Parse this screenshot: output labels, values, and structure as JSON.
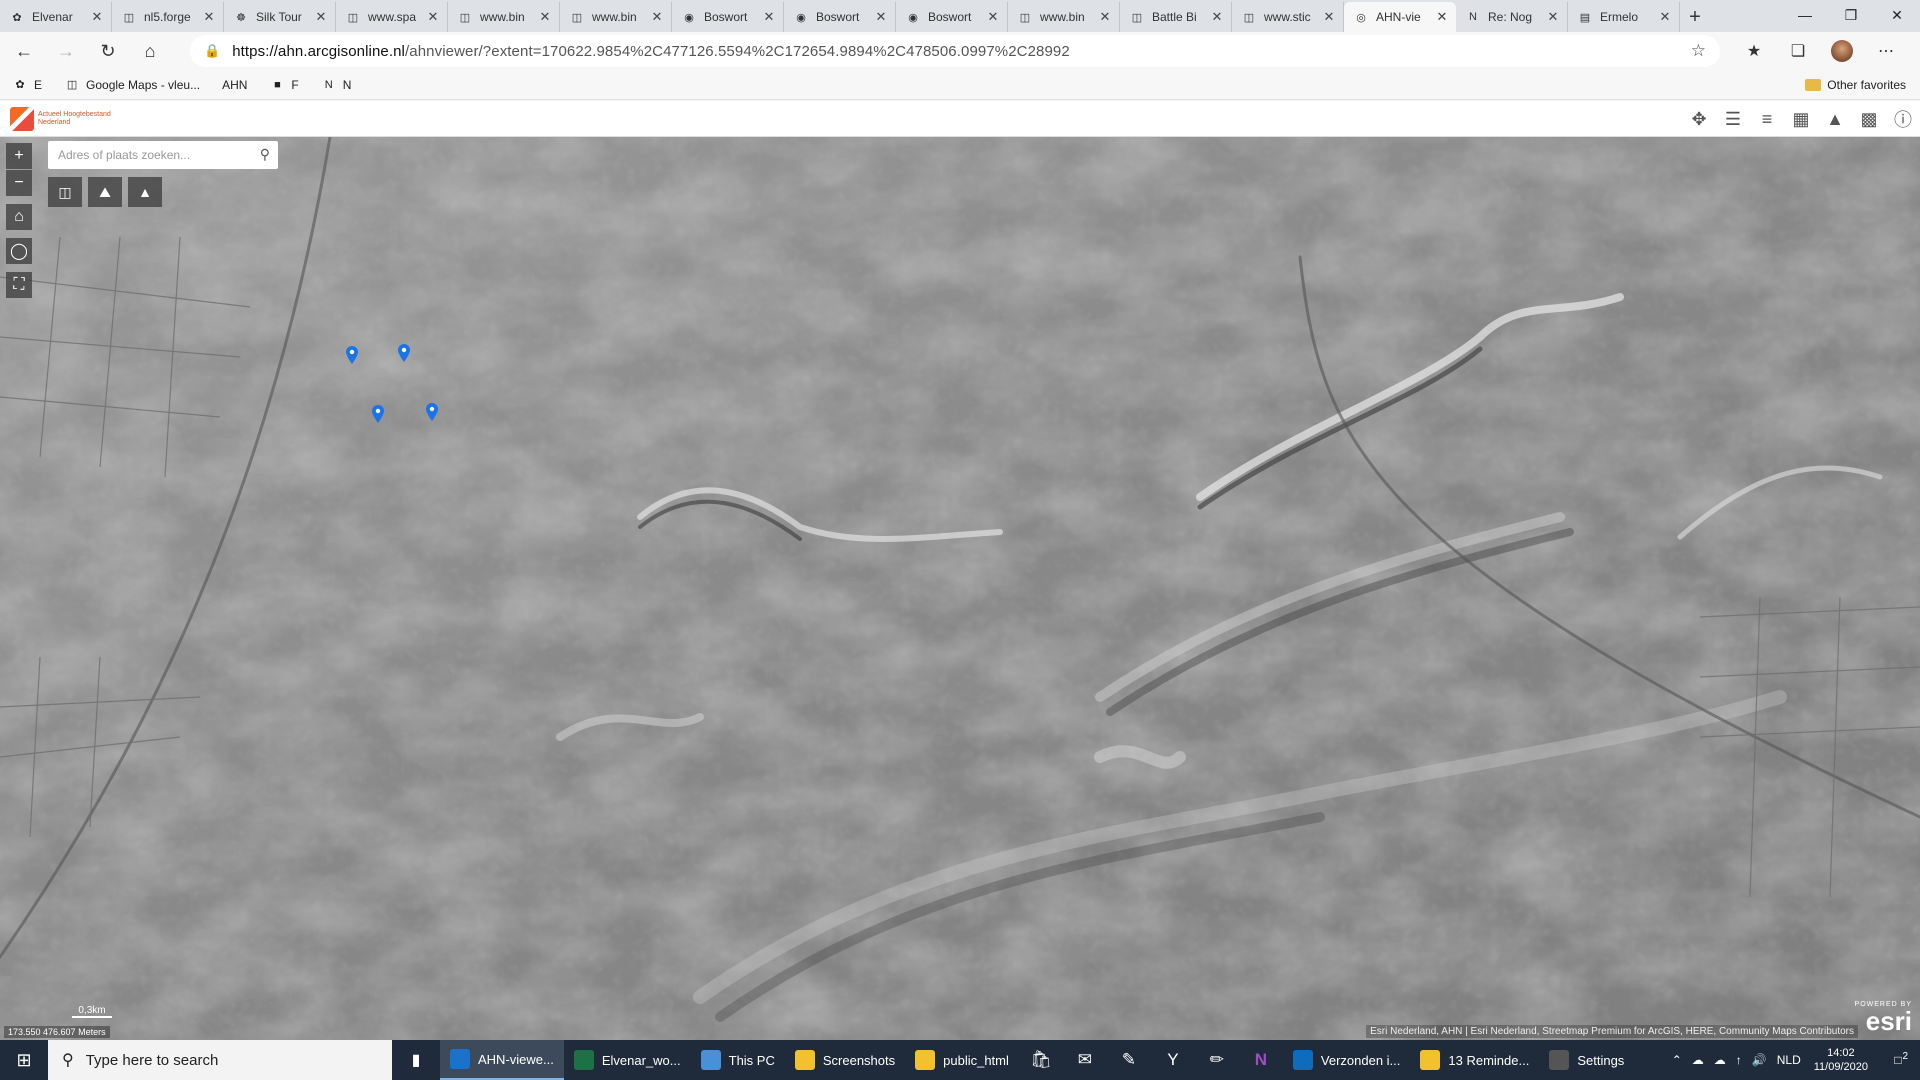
{
  "tabs": [
    {
      "title": "Elvenar",
      "icon": "elvenar-icon",
      "active": false
    },
    {
      "title": "nl5.forge",
      "icon": "page-icon",
      "active": false
    },
    {
      "title": "Silk Tour",
      "icon": "silk-icon",
      "active": false
    },
    {
      "title": "www.spa",
      "icon": "page-icon",
      "active": false
    },
    {
      "title": "www.bin",
      "icon": "page-icon",
      "active": false
    },
    {
      "title": "www.bin",
      "icon": "page-icon",
      "active": false
    },
    {
      "title": "Boswort",
      "icon": "bosworth-icon",
      "active": false
    },
    {
      "title": "Boswort",
      "icon": "bosworth-icon",
      "active": false
    },
    {
      "title": "Boswort",
      "icon": "bosworth-icon",
      "active": false
    },
    {
      "title": "www.bin",
      "icon": "page-icon",
      "active": false
    },
    {
      "title": "Battle Bi",
      "icon": "page-icon",
      "active": false
    },
    {
      "title": "www.stic",
      "icon": "page-icon",
      "active": false
    },
    {
      "title": "AHN-vie",
      "icon": "arcgis-icon",
      "active": true
    },
    {
      "title": "Re: Nog",
      "icon": "n-icon",
      "active": false
    },
    {
      "title": "Ermelo",
      "icon": "ermelo-icon",
      "active": false
    }
  ],
  "address": {
    "host": "https://ahn.arcgisonline.nl",
    "path": "/ahnviewer/?extent=170622.9854%2C477126.5594%2C172654.9894%2C478506.0997%2C28992"
  },
  "bookmarks": [
    {
      "label": "E",
      "icon": "elvenar-icon"
    },
    {
      "label": "Google Maps - vleu...",
      "icon": "page-icon"
    },
    {
      "label": "AHN",
      "icon": ""
    },
    {
      "label": "F",
      "icon": "forge-icon"
    },
    {
      "label": "N",
      "icon": "n-icon"
    }
  ],
  "other_favorites": "Other favorites",
  "app": {
    "logo_line1": "Actueel Hoogtebestand",
    "logo_line2": "Nederland"
  },
  "map": {
    "search_placeholder": "Adres of plaats zoeken...",
    "coords": "173.550 476.607 Meters",
    "scale": "0,3km",
    "attribution": "Esri Nederland, AHN | Esri Nederland, Streetmap Premium for ArcGIS, HERE, Community Maps Contributors",
    "esri_powered": "POWERED BY",
    "esri": "esri"
  },
  "taskbar": {
    "search_placeholder": "Type here to search",
    "apps": [
      {
        "label": "AHN-viewe...",
        "active": true,
        "color": "#1a73c8"
      },
      {
        "label": "Elvenar_wo...",
        "active": false,
        "color": "#1e7145"
      },
      {
        "label": "This PC",
        "active": false,
        "color": "#4a90d9"
      },
      {
        "label": "Screenshots",
        "active": false,
        "color": "#f2c12e"
      },
      {
        "label": "public_html",
        "active": false,
        "color": "#f2c12e"
      }
    ],
    "apps2": [
      {
        "label": "Verzonden i...",
        "color": "#0f6cbd"
      },
      {
        "label": "13 Reminde...",
        "color": "#f2c12e"
      },
      {
        "label": "Settings",
        "color": "#555"
      }
    ],
    "lang": "NLD",
    "time": "14:02",
    "date": "11/09/2020",
    "notif_count": "2"
  }
}
